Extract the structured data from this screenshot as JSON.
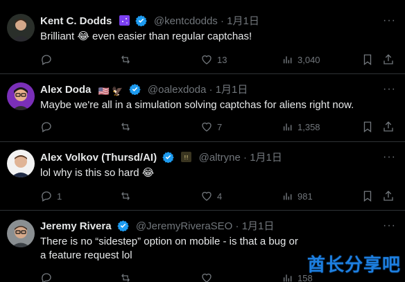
{
  "tweets": [
    {
      "name": "Kent C. Dodds",
      "name_emoji": "🌌",
      "handle": "@kentcdodds",
      "separator": "·",
      "date": "1月1日",
      "text": "Brilliant 😂 even easier than regular captchas!",
      "reply_count": "",
      "repost_count": "",
      "like_count": "13",
      "view_count": "3,040"
    },
    {
      "name": "Alex Doda",
      "name_emoji": "🇺🇸 🦅",
      "handle": "@oalexdoda",
      "separator": "·",
      "date": "1月1日",
      "text": "Maybe we're all in a simulation solving captchas for aliens right now.",
      "reply_count": "",
      "repost_count": "",
      "like_count": "7",
      "view_count": "1,358"
    },
    {
      "name": "Alex Volkov (Thursd/AI)",
      "name_emoji": "",
      "handle": "@altryne",
      "separator": "·",
      "date": "1月1日",
      "text": "lol why is this so hard 😂",
      "reply_count": "1",
      "repost_count": "",
      "like_count": "4",
      "view_count": "981"
    },
    {
      "name": "Jeremy Rivera",
      "name_emoji": "",
      "handle": "@JeremyRiveraSEO",
      "separator": "·",
      "date": "1月1日",
      "text": "There is no “sidestep” option on mobile - is that a bug or a feature request lol",
      "reply_count": "",
      "repost_count": "",
      "like_count": "",
      "view_count": "158"
    }
  ],
  "icons": {
    "verified": "verified-badge-icon",
    "reply": "reply-icon",
    "repost": "repost-icon",
    "like": "like-icon",
    "views": "views-icon",
    "bookmark": "bookmark-icon",
    "share": "share-icon",
    "more": "more-icon"
  },
  "colors": {
    "background": "#000000",
    "text": "#e7e9ea",
    "muted": "#71767b",
    "divider": "#2f3336",
    "verified": "#1d9bf0"
  },
  "watermark": "酋长分享吧"
}
